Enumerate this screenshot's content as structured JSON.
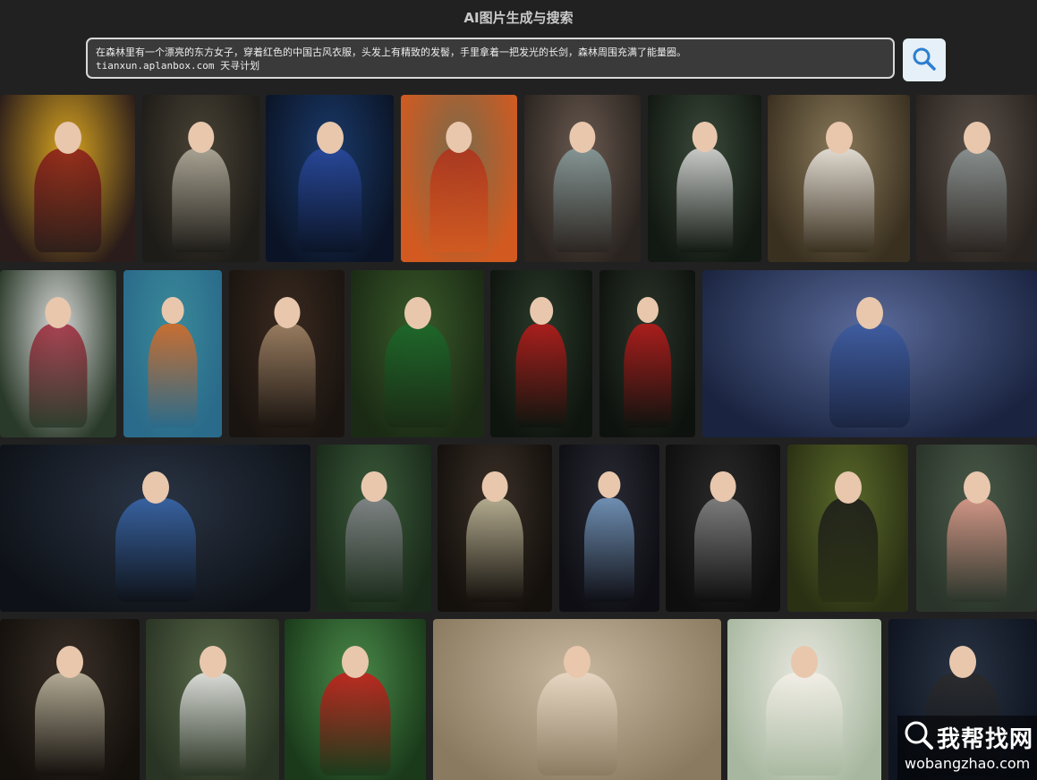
{
  "app": {
    "title": "AI图片生成与搜索"
  },
  "search": {
    "query": "在森林里有一个漂亮的东方女子，穿着红色的中国古风衣服，头发上有精致的发髻，手里拿着一把发光的长剑，森林周围充满了能量圈。\ntianxun.aplanbox.com 天寻计划",
    "button_icon": "search-icon",
    "accent_color": "#2b7fd0"
  },
  "gallery": {
    "rows": [
      [
        {
          "bg1": "#d9a520",
          "bg2": "#2a1c1a",
          "fig": "#8b1a1a"
        },
        {
          "bg1": "#4a4336",
          "bg2": "#1e1c18",
          "fig": "#b8b3a2"
        },
        {
          "bg1": "#1a3a6a",
          "bg2": "#0b1426",
          "fig": "#2a4aa0"
        },
        {
          "bg1": "#7a6a4a",
          "bg2": "#d25a20",
          "fig": "#b0301a"
        },
        {
          "bg1": "#6a5a50",
          "bg2": "#2a2420",
          "fig": "#8aa0a0"
        },
        {
          "bg1": "#3a4a3a",
          "bg2": "#121812",
          "fig": "#e0e0e0"
        },
        {
          "bg1": "#8a7a5a",
          "bg2": "#3a3020",
          "fig": "#f0ece6"
        },
        {
          "bg1": "#5a5048",
          "bg2": "#2a2420",
          "fig": "#909a9a"
        }
      ],
      [
        {
          "bg1": "#d8d8d8",
          "bg2": "#2a3a2a",
          "fig": "#a0283a"
        },
        {
          "bg1": "#3a8a9a",
          "bg2": "#2a6a8a",
          "fig": "#e06a20"
        },
        {
          "bg1": "#3a2a20",
          "bg2": "#1a1410",
          "fig": "#a88a6a"
        },
        {
          "bg1": "#3a5a2a",
          "bg2": "#1a2a14",
          "fig": "#1a6a2a"
        },
        {
          "bg1": "#2a3a2a",
          "bg2": "#0e140e",
          "fig": "#c01a1a"
        },
        {
          "bg1": "#2a342a",
          "bg2": "#0e120e",
          "fig": "#c01a1a"
        },
        {
          "bg1": "#5a6a9a",
          "bg2": "#1a2440",
          "fig": "#3a5aa0"
        }
      ],
      [
        {
          "bg1": "#2a3444",
          "bg2": "#0e1218",
          "fig": "#3a6ab0"
        },
        {
          "bg1": "#3a5a3a",
          "bg2": "#1a2a1a",
          "fig": "#8a8a90"
        },
        {
          "bg1": "#3a3028",
          "bg2": "#14100c",
          "fig": "#c8c0a0"
        },
        {
          "bg1": "#2a2a34",
          "bg2": "#0e0e14",
          "fig": "#7aa0c8"
        },
        {
          "bg1": "#2a2a2a",
          "bg2": "#0e0e0e",
          "fig": "#8a8a8a"
        },
        {
          "bg1": "#5a6a2a",
          "bg2": "#2a3014",
          "fig": "#1a1a1a"
        },
        {
          "bg1": "#4a5a4a",
          "bg2": "#2a342a",
          "fig": "#e8a090"
        }
      ],
      [
        {
          "bg1": "#3a3028",
          "bg2": "#14100c",
          "fig": "#c8c0a8"
        },
        {
          "bg1": "#5a6a4a",
          "bg2": "#2a3424",
          "fig": "#f0f0f0"
        },
        {
          "bg1": "#4a8a4a",
          "bg2": "#1a3a1a",
          "fig": "#d01a1a"
        },
        {
          "bg1": "#c8b8a0",
          "bg2": "#8a7a60",
          "fig": "#ecdcc8"
        },
        {
          "bg1": "#e8e8e0",
          "bg2": "#a8b8a0",
          "fig": "#f4f0e8"
        },
        {
          "bg1": "#2a3444",
          "bg2": "#0e1420",
          "fig": "#2a2a2a"
        }
      ]
    ]
  },
  "watermark": {
    "name": "我帮找网",
    "url": "wobangzhao.com",
    "icon": "magnifier-icon"
  }
}
